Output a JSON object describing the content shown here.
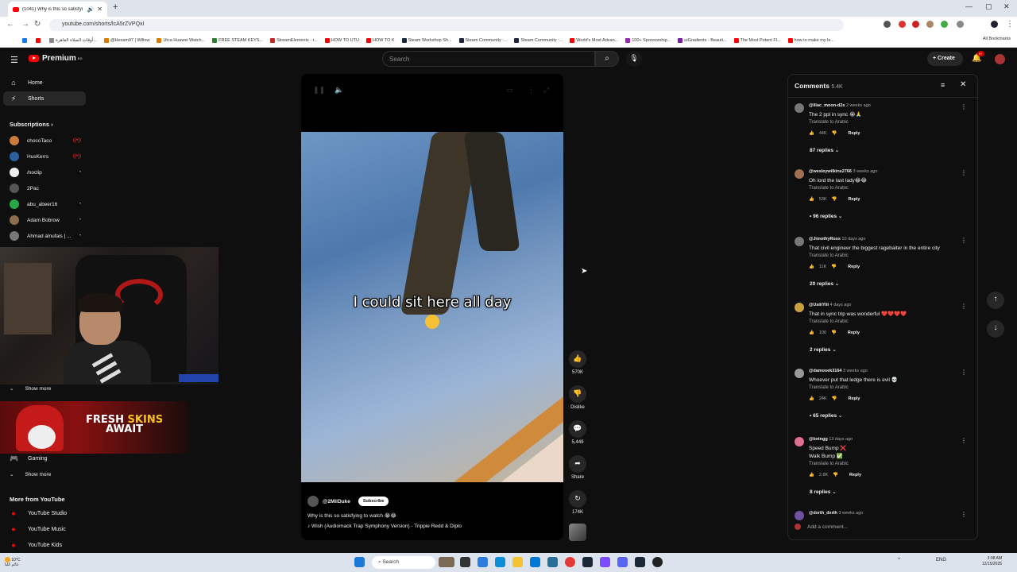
{
  "browser": {
    "tab_title": "(1041) Why is this so satisfyi",
    "url": "youtube.com/shorts/lcA5rZVPQxI",
    "bookmarks": [
      {
        "label": "",
        "color": "#1877f2"
      },
      {
        "label": "",
        "color": "#ff0000"
      },
      {
        "label": "أوقات الصلاة القاهرة...",
        "color": "#888"
      },
      {
        "label": "@Hexam97 | Willow",
        "color": "#e07a00"
      },
      {
        "label": "Utca Huawei Watch...",
        "color": "#e07a00"
      },
      {
        "label": "FREE STEAM KEYS...",
        "color": "#2d7d32"
      },
      {
        "label": "StreamElements - r...",
        "color": "#c62828"
      },
      {
        "label": "HOW TO UTU",
        "color": "#ff0000"
      },
      {
        "label": "HOW TO K",
        "color": "#ff0000"
      },
      {
        "label": "Steam Workshop Sh...",
        "color": "#1b2838"
      },
      {
        "label": "Steam Community :...",
        "color": "#1b2838"
      },
      {
        "label": "Steam Community :...",
        "color": "#1b2838"
      },
      {
        "label": "World's Most Advan...",
        "color": "#ff0000"
      },
      {
        "label": "100+ Sponsorship...",
        "color": "#9c27b0"
      },
      {
        "label": "uiGradients - Beauti...",
        "color": "#7b1fa2"
      },
      {
        "label": "The Most Potent Fl...",
        "color": "#ff0000"
      },
      {
        "label": "how to make my le...",
        "color": "#ff0000"
      }
    ],
    "all_bookmarks": "All Bookmarks"
  },
  "header": {
    "logo": "Premium",
    "logo_sup": "EG",
    "search_placeholder": "Search",
    "create": "Create",
    "notif_count": "9+"
  },
  "sidebar": {
    "home": "Home",
    "shorts": "Shorts",
    "subscriptions": "Subscriptions",
    "subs": [
      {
        "name": "chocoTaco",
        "color": "#c87b3a",
        "dot": "((•))",
        "dot_red": true
      },
      {
        "name": "HusKerrs",
        "color": "#2a5fa0",
        "dot": "((•))",
        "dot_red": true
      },
      {
        "name": "/noclip",
        "color": "#eee",
        "dot": "•",
        "dot_red": false
      },
      {
        "name": "2Pac",
        "color": "#555",
        "dot": "",
        "dot_red": false
      },
      {
        "name": "abu_abeer16",
        "color": "#27a745",
        "dot": "•",
        "dot_red": false
      },
      {
        "name": "Adam Bobrow",
        "color": "#8a6d4a",
        "dot": "•",
        "dot_red": false
      },
      {
        "name": "Ahmad alnufais | ...",
        "color": "#777",
        "dot": "•",
        "dot_red": false
      }
    ],
    "show_more_1": "Show more",
    "ad_line1": "FRESH",
    "ad_line1b": "SKINS",
    "ad_line2": "AWAIT",
    "gaming": "Gaming",
    "show_more_2": "Show more",
    "more_from": "More from YouTube",
    "more_items": [
      "YouTube Studio",
      "YouTube Music",
      "YouTube Kids"
    ]
  },
  "video": {
    "caption": "I could sit here all day",
    "channel": "@2MilDuke",
    "subscribe": "Subscribe",
    "title": "Why is this so satisfying to watch 😭😂",
    "song": "♪ Wish (Audiomack Trap Symphony Version) - Trippie Redd & Diplo"
  },
  "actions": {
    "likes": "570K",
    "dislike": "Dislike",
    "comments": "5,449",
    "share": "Share",
    "remix": "174K"
  },
  "comments_panel": {
    "title": "Comments",
    "count": "5.4K",
    "translate": "Translate to Arabic",
    "reply": "Reply",
    "items": [
      {
        "user": "@lilac_moon-d2s",
        "ago": "2 weeks ago",
        "text": "The 2 ppl in sync 😭🙏",
        "likes": "44K",
        "replies": "87 replies",
        "color": "#777"
      },
      {
        "user": "@wesleywilkins2766",
        "ago": "3 weeks ago",
        "text": "Oh lord the last lady😂😂",
        "likes": "53K",
        "replies": "• 96 replies",
        "color": "#a07050"
      },
      {
        "user": "@JimothyRoss",
        "ago": "10 days ago",
        "text": "That civil engineer the biggest ragebaiter in the entire city",
        "likes": "11K",
        "replies": "20 replies",
        "color": "#777"
      },
      {
        "user": "@UsiiiYiii",
        "ago": "4 days ago",
        "text": "That in sync trip was wonderful ❤️❤️❤️❤️",
        "likes": "100",
        "replies": "2 replies",
        "color": "#c9a040"
      },
      {
        "user": "@damosek3164",
        "ago": "3 weeks ago",
        "text": "Whoever put that ledge there is evil 💀",
        "likes": "24K",
        "replies": "• 65 replies",
        "color": "#999"
      },
      {
        "user": "@bxtngg",
        "ago": "13 days ago",
        "text": "Speed Bump ❌",
        "text2": "Walk Bump ✅",
        "likes": "2.8K",
        "replies": "8 replies",
        "color": "#e07090"
      },
      {
        "user": "@dxrth_dxrth",
        "ago": "3 weeks ago",
        "text": "",
        "likes": "",
        "replies": "",
        "color": "#7050a0"
      }
    ],
    "add_comment": "Add a comment..."
  },
  "taskbar": {
    "temp": "10°C",
    "weather": "غائم كليا",
    "search": "Search",
    "lang": "ENG",
    "time": "3:08 AM",
    "date": "12/15/2025"
  }
}
